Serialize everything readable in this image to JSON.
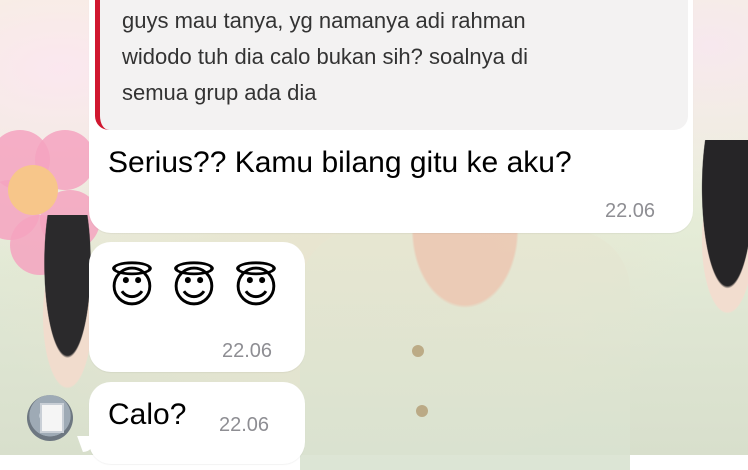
{
  "messages": {
    "quoted": {
      "lines": [
        "guys mau tanya, yg namanya adi rahman",
        "widodo tuh dia calo bukan sih? soalnya di",
        "semua grup ada dia"
      ]
    },
    "reply": {
      "text": "Serius?? Kamu bilang gitu ke aku?",
      "time": "22.06"
    },
    "emoji_msg": {
      "emojis": [
        "😇",
        "😇",
        "😇"
      ],
      "time": "22.06"
    },
    "last": {
      "text": "Calo?",
      "time": "22.06"
    }
  },
  "colors": {
    "quote_bar": "#d0172f",
    "bubble": "#ffffff",
    "timestamp": "#8e8e93"
  },
  "icons": {
    "avatar": "sender-avatar-icon"
  }
}
